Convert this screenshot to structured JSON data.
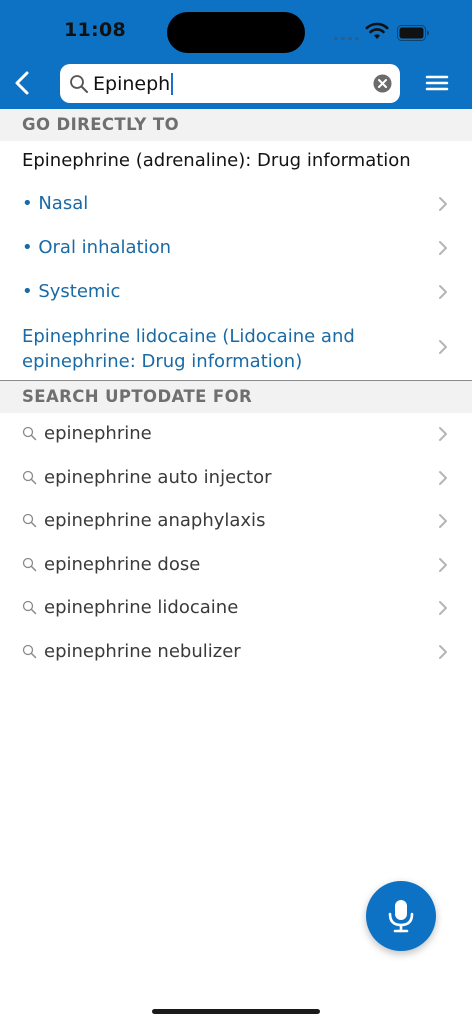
{
  "status": {
    "time": "11:08"
  },
  "search": {
    "value": "Epineph"
  },
  "go_directly": {
    "header": "GO DIRECTLY TO",
    "title": "Epinephrine (adrenaline): Drug information",
    "items": [
      {
        "label": "• Nasal"
      },
      {
        "label": "• Oral inhalation"
      },
      {
        "label": "• Systemic"
      }
    ],
    "related_line1": "Epinephrine lidocaine (Lidocaine and",
    "related_line2": "epinephrine: Drug information)"
  },
  "search_for": {
    "header": "SEARCH UPTODATE FOR",
    "suggestions": [
      {
        "label": "epinephrine"
      },
      {
        "label": "epinephrine auto injector"
      },
      {
        "label": "epinephrine anaphylaxis"
      },
      {
        "label": "epinephrine dose"
      },
      {
        "label": "epinephrine lidocaine"
      },
      {
        "label": "epinephrine nebulizer"
      }
    ]
  },
  "icons": {
    "back": "chevron-left-icon",
    "search": "magnifier-icon",
    "clear": "clear-circle-icon",
    "menu": "hamburger-menu-icon",
    "row": "chevron-right-icon",
    "mic": "microphone-icon"
  },
  "colors": {
    "header_bg": "#0e72c4",
    "link_blue": "#1a6aa6",
    "section_bg": "#f2f2f2",
    "section_text": "#6f6f6f"
  }
}
